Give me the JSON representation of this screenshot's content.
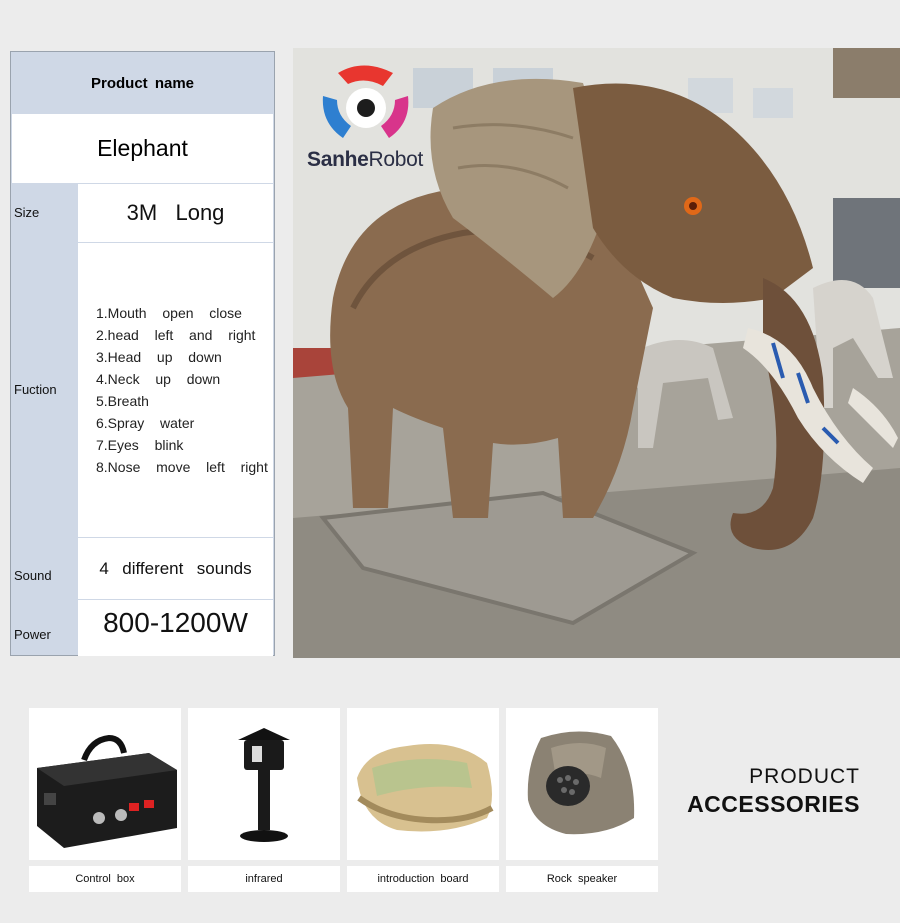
{
  "spec_table": {
    "header": "Product name",
    "product": "Elephant",
    "size_label": "Size",
    "size_value": "3M   Long",
    "function_label": "Fuction",
    "functions": [
      "1.Mouth  open  close",
      "2.head  left  and  right",
      "3.Head  up  down",
      "4.Neck  up  down",
      "5.Breath",
      "6.Spray  water",
      "7.Eyes  blink",
      "8.Nose  move  left  right"
    ],
    "sound_label": "Sound",
    "sound_value": "4  different  sounds",
    "power_label": "Power",
    "power_value": "800-1200W"
  },
  "brand": {
    "bold": "Sanhe",
    "light": "Robot"
  },
  "accessories_title": {
    "line1": "PRODUCT",
    "line2": "ACCESSORIES"
  },
  "accessories": [
    {
      "caption": "Control  box",
      "icon": "control-box-icon"
    },
    {
      "caption": "infrared",
      "icon": "infrared-sensor-icon"
    },
    {
      "caption": "introduction  board",
      "icon": "rock-board-icon"
    },
    {
      "caption": "Rock  speaker",
      "icon": "rock-speaker-icon"
    }
  ],
  "colors": {
    "table_label_bg": "#cfd8e6",
    "page_bg": "#ececec",
    "logo_red": "#e8362f",
    "logo_blue": "#2e7fd0",
    "logo_pink": "#d8348b"
  }
}
